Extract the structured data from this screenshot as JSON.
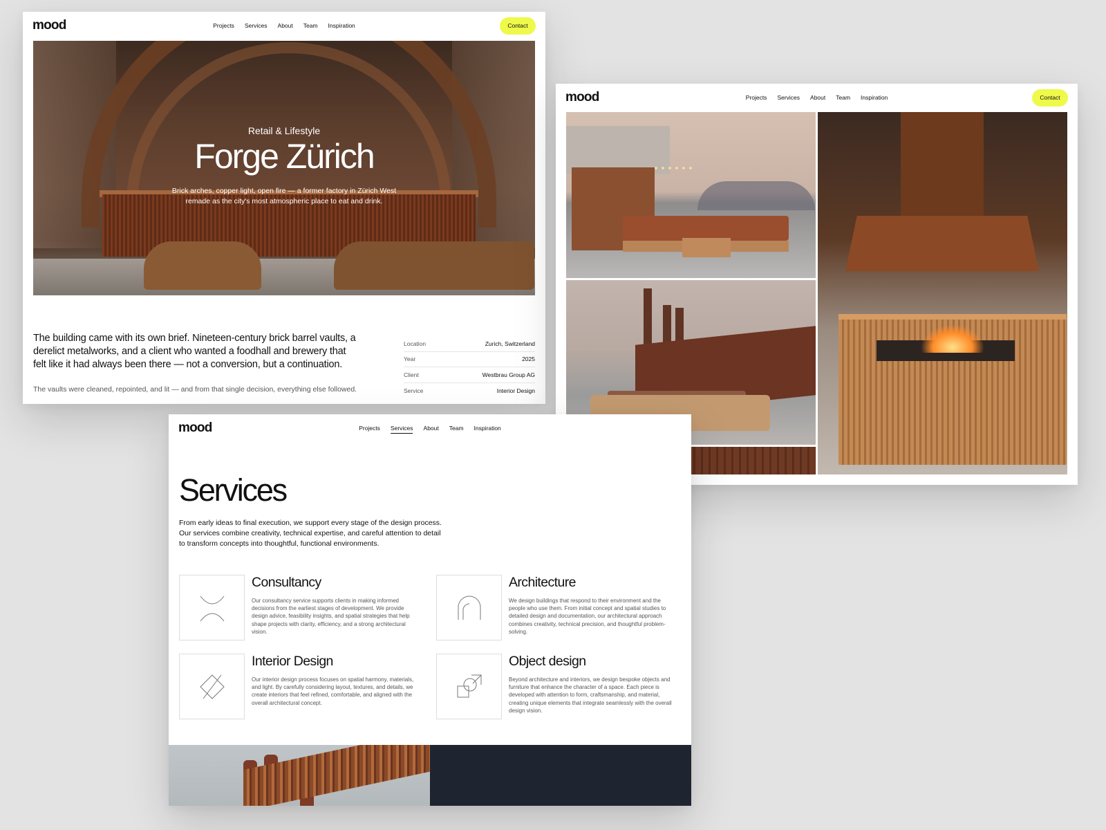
{
  "nav": {
    "logo": "mood",
    "items": [
      "Projects",
      "Services",
      "About",
      "Team",
      "Inspiration"
    ],
    "contact_label": "Contact",
    "contact_color": "#eef94a"
  },
  "project": {
    "category": "Retail & Lifestyle",
    "title": "Forge Zürich",
    "description": "Brick arches, copper light, open fire — a former factory in Zürich West remade as the city's most atmospheric place to eat and drink.",
    "intro": "The building came with its own brief. Nineteen-century brick barrel vaults, a derelict metalworks, and a client who wanted a foodhall and brewery that felt like it had always been there — not a conversion, but a continuation.",
    "intro_sub": "The vaults were cleaned, repointed, and lit — and from that single decision, everything else followed.",
    "facts": [
      {
        "label": "Location",
        "value": "Zurich, Switzerland"
      },
      {
        "label": "Year",
        "value": "2025"
      },
      {
        "label": "Client",
        "value": "Westbrau Group AG"
      },
      {
        "label": "Service",
        "value": "Interior Design"
      }
    ]
  },
  "services_page": {
    "active_nav": "Services",
    "title": "Services",
    "intro": "From early ideas to final execution, we support every stage of the design process. Our services combine creativity, technical expertise, and careful attention to detail to transform concepts into thoughtful, functional environments.",
    "items": [
      {
        "name": "Consultancy",
        "icon": "consultancy-icon",
        "description": "Our consultancy service supports clients in making informed decisions from the earliest stages of development. We provide design advice, feasibility insights, and spatial strategies that help shape projects with clarity, efficiency, and a strong architectural vision."
      },
      {
        "name": "Architecture",
        "icon": "architecture-arch-icon",
        "description": "We design buildings that respond to their environment and the people who use them. From initial concept and spatial studies to detailed design and documentation, our architectural approach combines creativity, technical precision, and thoughtful problem-solving."
      },
      {
        "name": "Interior Design",
        "icon": "interior-diamond-icon",
        "description": "Our interior design process focuses on spatial harmony, materials, and light. By carefully considering layout, textures, and details, we create interiors that feel refined, comfortable, and aligned with the overall architectural concept."
      },
      {
        "name": "Object design",
        "icon": "object-shapes-icon",
        "description": "Beyond architecture and interiors, we design bespoke objects and furniture that enhance the character of a space. Each piece is developed with attention to form, craftsmanship, and material, creating unique elements that integrate seamlessly with the overall design vision."
      }
    ]
  },
  "colors": {
    "background": "#e3e3e3",
    "accent": "#eef94a",
    "dark_panel": "#1f2530"
  }
}
